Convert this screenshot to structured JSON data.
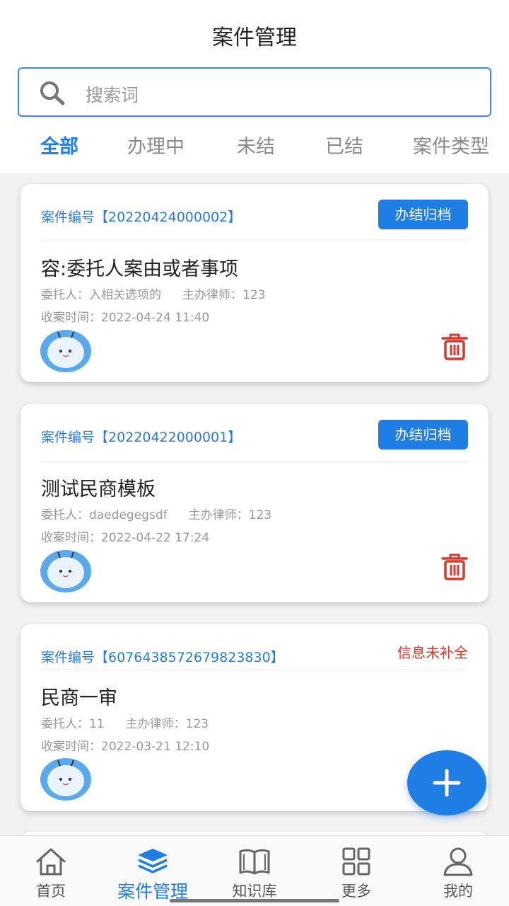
{
  "header": {
    "title": "案件管理",
    "search_placeholder": "搜索词"
  },
  "tabs": [
    {
      "label": "全部",
      "active": true
    },
    {
      "label": "办理中",
      "active": false
    },
    {
      "label": "未结",
      "active": false
    },
    {
      "label": "已结",
      "active": false
    },
    {
      "label": "案件类型",
      "active": false
    }
  ],
  "cases": [
    {
      "case_no": "案件编号【20220424000002】",
      "status_button": "办结归档",
      "title": "容:委托人案由或者事项",
      "client": "委托人：入相关选项的",
      "lawyer": "主办律师：123",
      "received": "收案时间：2022-04-24 11:40"
    },
    {
      "case_no": "案件编号【20220422000001】",
      "status_button": "办结归档",
      "title": "测试民商模板",
      "client": "委托人：daedegegsdf",
      "lawyer": "主办律师：123",
      "received": "收案时间：2022-04-22 17:24"
    },
    {
      "case_no": "案件编号【6076438572679823830】",
      "status_text": "信息未补全",
      "title": "民商一审",
      "client": "委托人：11",
      "lawyer": "主办律师：123",
      "received": "收案时间：2022-03-21 12:10"
    }
  ],
  "bottom_nav": [
    {
      "label": "首页",
      "icon": "home-icon"
    },
    {
      "label": "案件管理",
      "icon": "layers-icon",
      "active": true
    },
    {
      "label": "知识库",
      "icon": "book-icon"
    },
    {
      "label": "更多",
      "icon": "grid-icon"
    },
    {
      "label": "我的",
      "icon": "user-icon"
    }
  ],
  "colors": {
    "accent": "#1f7ee6",
    "warning": "#d23a2f",
    "delete": "#d23a2f"
  }
}
